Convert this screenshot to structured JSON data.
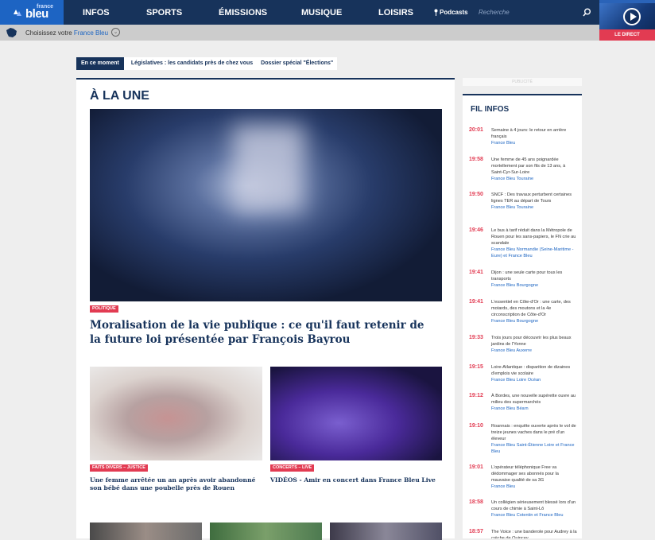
{
  "brand": {
    "logo_top": "france",
    "logo_main": "bleu"
  },
  "nav": {
    "items": [
      "INFOS",
      "SPORTS",
      "ÉMISSIONS",
      "MUSIQUE",
      "LOISIRS"
    ],
    "podcasts": "Podcasts",
    "search_placeholder": "Recherche"
  },
  "live": {
    "label": "LE DIRECT"
  },
  "region": {
    "prefix": "Choisissez votre",
    "link": "France Bleu"
  },
  "moment": {
    "tag": "En ce moment",
    "links": [
      "Législatives : les candidats près de chez vous",
      "Dossier spécial \"Élections\""
    ]
  },
  "une": {
    "title": "À LA UNE",
    "hero": {
      "category": "POLITIQUE",
      "headline": "Moralisation de la vie publique : ce qu'il faut retenir de la future loi présentée par François Bayrou"
    },
    "articles": [
      {
        "category": "FAITS DIVERS – JUSTICE",
        "headline": "Une femme arrêtée un an après avoir abandonné son bébé dans une poubelle près de Rouen"
      },
      {
        "category": "CONCERTS – LIVE",
        "headline": "VIDÉOS - Amir en concert dans France Bleu Live"
      }
    ]
  },
  "ad": {
    "label": "PUBLICITÉ"
  },
  "fil": {
    "title": "FIL INFOS",
    "items": [
      {
        "time": "20:01",
        "text": "Semaine à 4 jours: le retour en arrière français",
        "source": "France Bleu"
      },
      {
        "time": "19:58",
        "text": "Une femme de 45 ans poignardée mortellement par son fils de 13 ans, à Saint-Cyr-Sur-Loire",
        "source": "France Bleu Touraine"
      },
      {
        "time": "19:50",
        "text": "SNCF : Des travaux perturbent certaines lignes TER au départ de Tours",
        "source": "France Bleu Touraine"
      },
      {
        "time": "19:46",
        "text": "Le bus à tarif réduit dans la Métropole de Rouen pour les sans-papiers, le FN crie au scandale",
        "source": "France Bleu Normandie (Seine-Maritime - Eure) et France Bleu"
      },
      {
        "time": "19:41",
        "text": "Dijon : une seule carte pour tous les transports",
        "source": "France Bleu Bourgogne"
      },
      {
        "time": "19:41",
        "text": "L'essentiel en Côte-d'Or : une carte, des motards, des moutons et la 4e circonscription de Côte-d'Or",
        "source": "France Bleu Bourgogne"
      },
      {
        "time": "19:33",
        "text": "Trois jours pour découvrir les plus beaux jardins de l'Yonne",
        "source": "France Bleu Auxerre"
      },
      {
        "time": "19:15",
        "text": "Loire-Atlantique : disparition de dizaines d'emplois vie scolaire",
        "source": "France Bleu Loire Océan"
      },
      {
        "time": "19:12",
        "text": "À Bordes, une nouvelle supérette ouvre au milieu des supermarchés",
        "source": "France Bleu Béarn"
      },
      {
        "time": "19:10",
        "text": "Roannais : enquête ouverte après le vol de treize jeunes vaches dans le pré d'un éleveur",
        "source": "France Bleu Saint-Étienne Loire et France Bleu"
      },
      {
        "time": "19:01",
        "text": "L'opérateur téléphonique Free va dédommager ses abonnés pour la mauvaise qualité de sa 3G",
        "source": "France Bleu"
      },
      {
        "time": "18:58",
        "text": "Un collégien sérieusement blessé lors d'un cours de chimie à Saint-Lô",
        "source": "France Bleu Cotentin et France Bleu"
      },
      {
        "time": "18:57",
        "text": "The Voice : une banderole pour Audrey à la crèche de Quincey",
        "source": ""
      }
    ]
  }
}
